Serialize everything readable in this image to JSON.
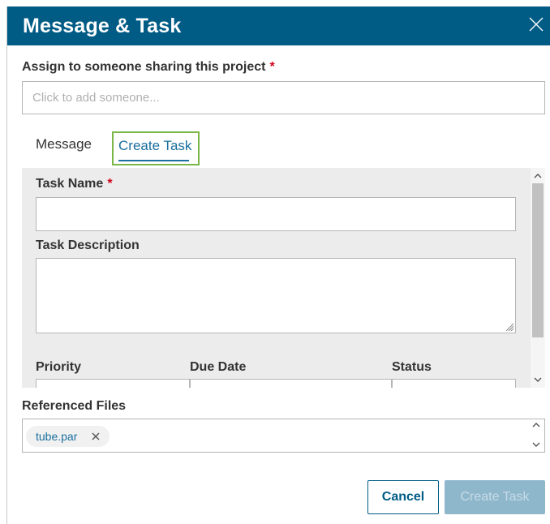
{
  "dialog": {
    "title": "Message & Task",
    "close_icon": "close-icon"
  },
  "assign": {
    "label": "Assign to someone sharing this project",
    "required_mark": "*",
    "placeholder": "Click to add someone..."
  },
  "tabs": [
    {
      "label": "Message",
      "selected": false
    },
    {
      "label": "Create Task",
      "selected": true
    }
  ],
  "task_form": {
    "task_name_label": "Task Name",
    "task_name_required_mark": "*",
    "task_name_value": "",
    "description_label": "Task Description",
    "description_value": "",
    "priority_label": "Priority",
    "due_date_label": "Due Date",
    "status_label": "Status"
  },
  "referenced_files": {
    "label": "Referenced Files",
    "files": [
      {
        "name": "tube.par"
      }
    ]
  },
  "buttons": {
    "cancel": "Cancel",
    "create_task": "Create Task"
  },
  "colors": {
    "header": "#005b85",
    "accent": "#1b6f9e",
    "focus_outline": "#7ab648",
    "required": "#d0021b",
    "disabled_button": "#8fb7cc"
  }
}
